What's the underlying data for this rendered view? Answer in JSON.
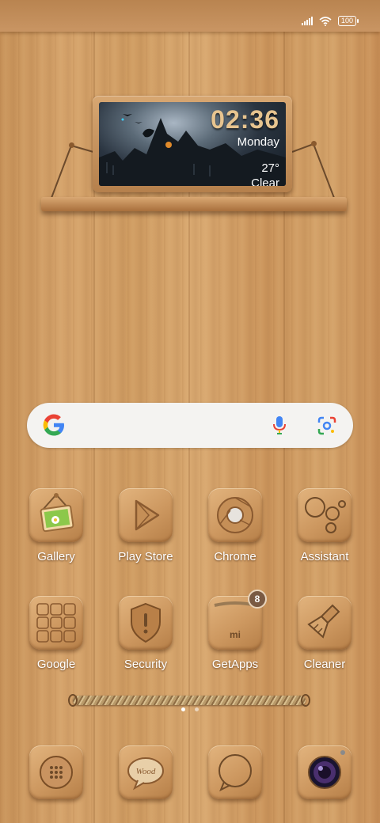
{
  "status_bar": {
    "battery": "100"
  },
  "clock_widget": {
    "time": "02:36",
    "day": "Monday",
    "temperature": "27°",
    "condition": "Clear"
  },
  "search": {
    "google_icon": "google-g-icon",
    "mic_icon": "microphone-icon",
    "lens_icon": "google-lens-icon"
  },
  "apps_row1": [
    {
      "label": "Gallery",
      "icon": "gallery-icon"
    },
    {
      "label": "Play Store",
      "icon": "play-store-icon"
    },
    {
      "label": "Chrome",
      "icon": "chrome-icon"
    },
    {
      "label": "Assistant",
      "icon": "assistant-icon"
    }
  ],
  "apps_row2": [
    {
      "label": "Google",
      "icon": "google-folder-icon"
    },
    {
      "label": "Security",
      "icon": "security-shield-icon"
    },
    {
      "label": "GetApps",
      "icon": "getapps-icon",
      "badge": "8"
    },
    {
      "label": "Cleaner",
      "icon": "cleaner-brush-icon"
    }
  ],
  "dock": [
    {
      "icon": "phone-dialer-icon"
    },
    {
      "icon": "messages-icon",
      "text": "Wood"
    },
    {
      "icon": "browser-icon"
    },
    {
      "icon": "camera-icon"
    }
  ],
  "page_indicator": {
    "pages": 2,
    "current": 1
  },
  "colors": {
    "wood": "#d4a36a",
    "shelf": "#b5804c",
    "clock_digits": "#e7c48f",
    "label": "#ffffff"
  }
}
